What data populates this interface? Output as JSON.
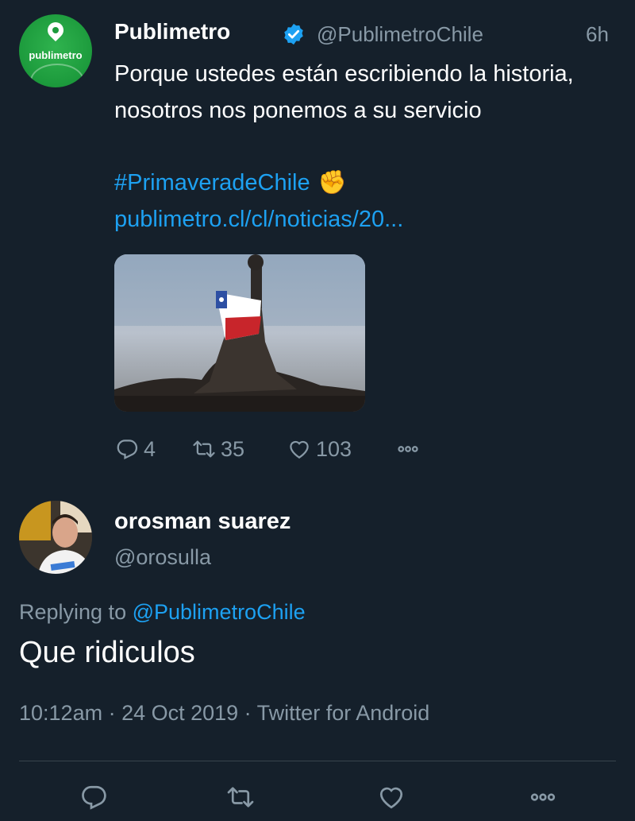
{
  "quoted_tweet": {
    "author_name": "Publimetro",
    "handle": "@PublimetroChile",
    "time_ago": "6h",
    "avatar_brand": "publimetro",
    "text": "Porque ustedes están escribiendo la historia, nosotros nos ponemos a su servicio",
    "hashtag": "#PrimaveradeChile",
    "emoji": "✊",
    "link": "publimetro.cl/cl/noticias/20...",
    "stats": {
      "replies": "4",
      "retweets": "35",
      "likes": "103"
    }
  },
  "reply_tweet": {
    "author_name": "orosman suarez",
    "handle": "@orosulla",
    "replying_prefix": "Replying to",
    "replying_to": "@PublimetroChile",
    "text": "Que ridiculos",
    "timestamp": "10:12am · 24 Oct 2019 · Twitter for Android"
  },
  "icons": {
    "reply": "reply-icon",
    "retweet": "retweet-icon",
    "like": "heart-icon",
    "more": "more-icon",
    "verified": "verified-badge-icon"
  },
  "colors": {
    "background": "#15202b",
    "link": "#1da1f2",
    "muted": "#8899a6",
    "divider": "#38444d"
  }
}
